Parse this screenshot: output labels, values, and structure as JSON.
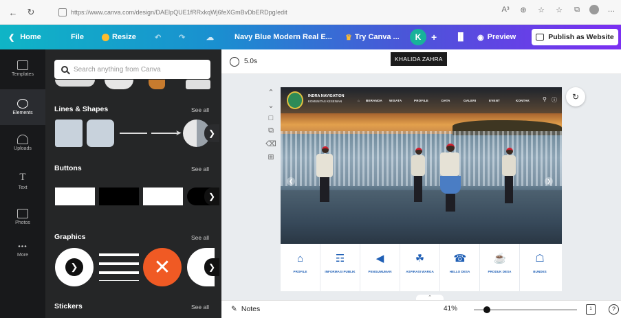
{
  "browser": {
    "url": "https://www.canva.com/design/DAElpQUE1fRRxkqWj6feXGmBvDbERDpg/edit",
    "right_icons": [
      "A³",
      "⊕",
      "☆",
      "☆",
      "⧉",
      "…"
    ]
  },
  "header": {
    "home_label": "Home",
    "file_label": "File",
    "resize_label": "Resize",
    "design_title": "Navy Blue Modern Real E...",
    "try_canva_label": "Try Canva ...",
    "avatar_initial": "K",
    "preview_label": "Preview",
    "publish_label": "Publish as Website",
    "tooltip_name": "KHALIDA ZAHRA",
    "accent_start": "#0fb5c6",
    "accent_end": "#7b2ff2"
  },
  "rail": {
    "items": [
      {
        "label": "Templates",
        "icon": "templates-icon"
      },
      {
        "label": "Elements",
        "icon": "elements-icon",
        "active": true
      },
      {
        "label": "Uploads",
        "icon": "uploads-icon"
      },
      {
        "label": "Text",
        "icon": "text-icon"
      },
      {
        "label": "Photos",
        "icon": "photos-icon"
      },
      {
        "label": "More",
        "icon": "more-icon"
      }
    ]
  },
  "panel": {
    "search_placeholder": "Search anything from Canva",
    "sections": [
      {
        "title": "Lines & Shapes",
        "see_all": "See all"
      },
      {
        "title": "Buttons",
        "see_all": "See all"
      },
      {
        "title": "Graphics",
        "see_all": "See all"
      },
      {
        "title": "Stickers",
        "see_all": "See all"
      }
    ]
  },
  "timebar": {
    "duration": "5.0s"
  },
  "design": {
    "brand_line1": "INDRA NAVIGATION",
    "brand_line2": "KOMUNITAS KESENIAN",
    "nav_links": [
      "BERANDA",
      "WISATA",
      "PROFILE",
      "DATA",
      "GALERI",
      "EVENT",
      "KONTAK"
    ],
    "menu": [
      {
        "label": "PROFILE",
        "icon": "⌂"
      },
      {
        "label": "INFORMASI PUBLIK",
        "icon": "☶"
      },
      {
        "label": "PENGUMUMAN",
        "icon": "◀"
      },
      {
        "label": "ASPIRASI WARGA",
        "icon": "☘"
      },
      {
        "label": "HELLO DESA",
        "icon": "☎"
      },
      {
        "label": "PRODUK DESA",
        "icon": "☕"
      },
      {
        "label": "BUNDES",
        "icon": "☖"
      }
    ]
  },
  "bottombar": {
    "notes_label": "Notes",
    "zoom_label": "41%",
    "zoom_fraction": 0.41,
    "page_count": "1"
  }
}
